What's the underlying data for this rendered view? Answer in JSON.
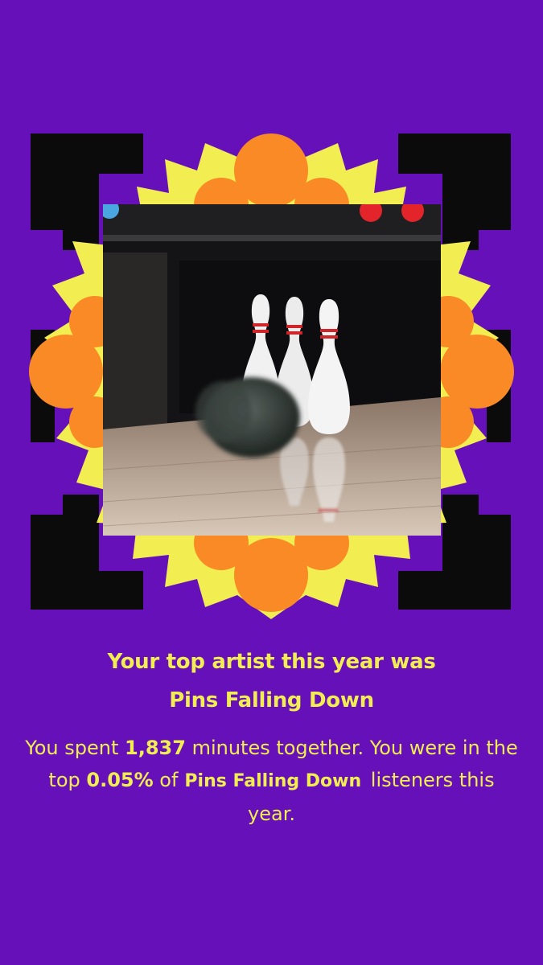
{
  "colors": {
    "background": "#6510b8",
    "accent_yellow": "#f2ee52",
    "frame_orange": "#f98a25",
    "frame_black": "#0b0b0b"
  },
  "image": {
    "subject": "bowling ball hitting three pins",
    "icon": "bowling-photo"
  },
  "headline": "Your top artist this year was",
  "artist_name": "Pins Falling Down",
  "stats": {
    "prefix": "You spent",
    "minutes": "1,837",
    "middle": "minutes together. You were in the top",
    "percentile": "0.05%",
    "of": "of",
    "artist": "Pins Falling Down",
    "suffix": "listeners this year."
  }
}
